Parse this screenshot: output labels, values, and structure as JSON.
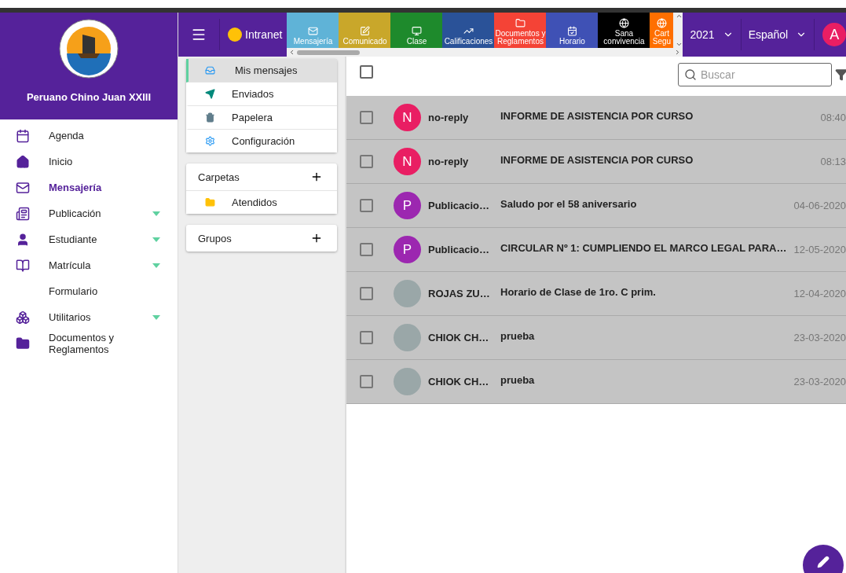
{
  "sidebar": {
    "school_name": "Peruano Chino Juan XXIII",
    "items": [
      {
        "label": "Agenda",
        "selected": false,
        "expandable": false
      },
      {
        "label": "Inicio",
        "selected": false,
        "expandable": false
      },
      {
        "label": "Mensajería",
        "selected": true,
        "expandable": false
      },
      {
        "label": "Publicación",
        "selected": false,
        "expandable": true
      },
      {
        "label": "Estudiante",
        "selected": false,
        "expandable": true
      },
      {
        "label": "Matrícula",
        "selected": false,
        "expandable": true
      },
      {
        "label": "Formulario",
        "selected": false,
        "expandable": false
      },
      {
        "label": "Utilitarios",
        "selected": false,
        "expandable": true
      },
      {
        "label": "Documentos y Reglamentos",
        "selected": false,
        "expandable": false
      }
    ]
  },
  "topbar": {
    "app_label": "Intranet",
    "modules": [
      {
        "label": "Mensajería",
        "color": "#5fb3d7"
      },
      {
        "label": "Comunicado",
        "color": "#c9a72a"
      },
      {
        "label": "Clase",
        "color": "#1e8a2c"
      },
      {
        "label": "Calificaciones",
        "color": "#2a5298"
      },
      {
        "label": "Documentos y Reglamentos",
        "color": "#f44336"
      },
      {
        "label": "Horario",
        "color": "#3f51b5"
      },
      {
        "label": "Sana convivencia",
        "color": "#000000"
      },
      {
        "label": "Cart Segu",
        "color": "#ff6f00"
      }
    ],
    "year": "2021",
    "language": "Español",
    "user_initial": "A"
  },
  "mail_menu": [
    {
      "label": "Mis mensajes",
      "selected": true
    },
    {
      "label": "Enviados",
      "selected": false
    },
    {
      "label": "Papelera",
      "selected": false
    },
    {
      "label": "Configuración",
      "selected": false
    }
  ],
  "folders": {
    "title": "Carpetas",
    "items": [
      {
        "label": "Atendidos"
      }
    ]
  },
  "groups": {
    "title": "Grupos"
  },
  "search": {
    "placeholder": "Buscar"
  },
  "select_all": {
    "checked": false
  },
  "messages": [
    {
      "kind": "letter",
      "initial": "N",
      "color": "#e91e63",
      "checked": false,
      "sender": "no-reply",
      "subject": "INFORME DE ASISTENCIA POR CURSO",
      "date": "08:40"
    },
    {
      "kind": "letter",
      "initial": "N",
      "color": "#e91e63",
      "checked": false,
      "sender": "no-reply",
      "subject": "INFORME DE ASISTENCIA POR CURSO",
      "date": "08:13"
    },
    {
      "kind": "letter",
      "initial": "P",
      "color": "#9c27b0",
      "checked": false,
      "sender": "Publicacio…",
      "subject": "Saludo por el 58 aniversario",
      "date": "04-06-2020"
    },
    {
      "kind": "letter",
      "initial": "P",
      "color": "#9c27b0",
      "checked": false,
      "sender": "Publicacio…",
      "subject": "CIRCULAR Nº 1: CUMPLIENDO EL MARCO LEGAL PARA…",
      "date": "12-05-2020"
    },
    {
      "kind": "photo",
      "checked": false,
      "sender": "ROJAS ZU…",
      "subject": "Horario de Clase de 1ro. C prim.",
      "date": "12-04-2020"
    },
    {
      "kind": "photo",
      "checked": false,
      "sender": "CHIOK CH…",
      "subject": "prueba",
      "date": "23-03-2020"
    },
    {
      "kind": "photo",
      "checked": false,
      "sender": "CHIOK CH…",
      "subject": "prueba",
      "date": "23-03-2020"
    }
  ]
}
